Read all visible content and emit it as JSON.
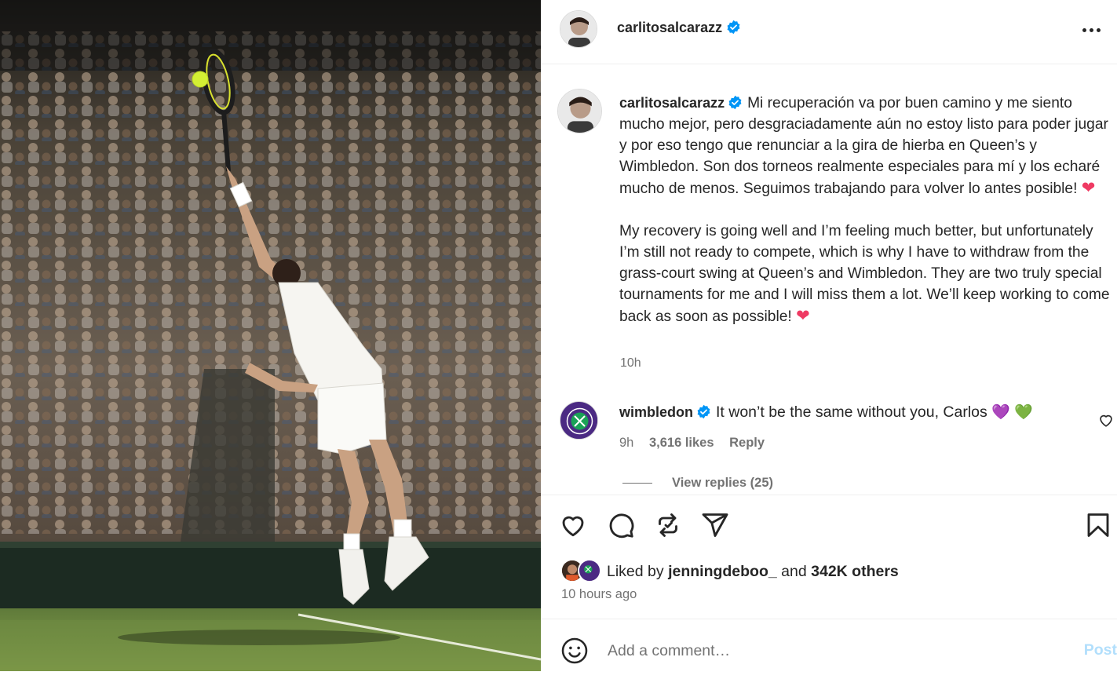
{
  "colors": {
    "verified": "#0095f6",
    "heart": "#ef3a63",
    "wimbledon_purple": "#4b2a83",
    "wimbledon_green": "#1aa356",
    "post_disabled": "#b2dffc",
    "secondary_text": "#737373"
  },
  "post": {
    "photo_alt": "Tennis player serving on grass court in front of crowd"
  },
  "header": {
    "username": "carlitosalcarazz",
    "verified": true,
    "more_icon": "more-horizontal-icon"
  },
  "caption": {
    "username": "carlitosalcarazz",
    "spanish": "Mi recuperación va por buen camino y me siento mucho mejor, pero desgraciadamente aún no estoy listo para poder jugar y por eso tengo que renunciar a la gira de hierba en Queen’s y Wimbledon. Son dos torneos realmente especiales para mí y los echaré mucho de menos. Seguimos trabajando para volver lo antes posible!",
    "english": "My recovery is going well and I’m feeling much better, but unfortunately I’m still not ready to compete, which is why I have to withdraw from the grass-court swing at Queen’s and Wimbledon. They are two truly special tournaments for me and I will miss them a lot. We’ll keep working to come back as soon as possible!",
    "heart_emoji": "❤",
    "time": "10h"
  },
  "comment": {
    "username": "wimbledon",
    "text": "It won’t be the same without you, Carlos",
    "emoji_purple": "💜",
    "emoji_green": "💚",
    "time": "9h",
    "likes": "3,616 likes",
    "reply_label": "Reply",
    "view_replies": "View replies (25)"
  },
  "actions": {
    "like_icon": "heart-icon",
    "comment_icon": "comment-icon",
    "repost_icon": "repost-icon",
    "share_icon": "send-icon",
    "save_icon": "bookmark-icon"
  },
  "likes": {
    "prefix": "Liked by",
    "user": "jenningdeboo_",
    "middle": "and",
    "others": "342K others",
    "posted_ago": "10 hours ago"
  },
  "add_comment": {
    "placeholder": "Add a comment…",
    "post_label": "Post"
  }
}
